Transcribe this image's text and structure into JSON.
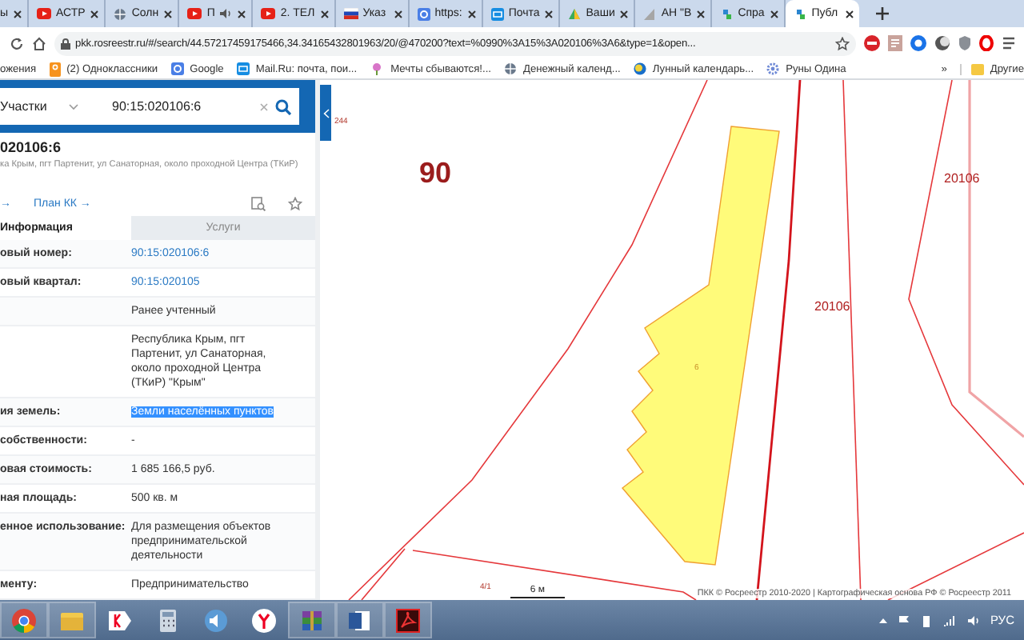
{
  "browser": {
    "tabs": [
      {
        "title": "ы",
        "kind": "none",
        "audio": false,
        "selected": false
      },
      {
        "title": "АСТР",
        "kind": "youtube",
        "audio": false,
        "selected": false
      },
      {
        "title": "Солн",
        "kind": "globe",
        "audio": false,
        "selected": false
      },
      {
        "title": "П",
        "kind": "youtube",
        "audio": true,
        "selected": false
      },
      {
        "title": "2. ТЕЛ",
        "kind": "youtube",
        "audio": false,
        "selected": false
      },
      {
        "title": "Указ",
        "kind": "flag",
        "audio": false,
        "selected": false
      },
      {
        "title": "https:",
        "kind": "google",
        "audio": false,
        "selected": false
      },
      {
        "title": "Почта",
        "kind": "mail",
        "audio": false,
        "selected": false
      },
      {
        "title": "Ваши",
        "kind": "drive",
        "audio": false,
        "selected": false
      },
      {
        "title": "АН \"В",
        "kind": "triangle",
        "audio": false,
        "selected": false
      },
      {
        "title": "Спра",
        "kind": "pkk",
        "audio": false,
        "selected": false
      },
      {
        "title": "Публ",
        "kind": "pkk",
        "audio": false,
        "selected": true
      }
    ],
    "url": "pkk.rosreestr.ru/#/search/44.57217459175466,34.34165432801963/20/@470200?text=%0990%3A15%3A020106%3A6&type=1&open...",
    "bookmarks": [
      {
        "title": "ожения",
        "kind": "none"
      },
      {
        "title": "(2) Одноклассники",
        "kind": "ok"
      },
      {
        "title": "Google",
        "kind": "google"
      },
      {
        "title": "Mail.Ru: почта, пои...",
        "kind": "mail"
      },
      {
        "title": "Мечты сбываются!...",
        "kind": "flower"
      },
      {
        "title": "Денежный календ...",
        "kind": "globe"
      },
      {
        "title": "Лунный календарь...",
        "kind": "moon"
      },
      {
        "title": "Руны Одина",
        "kind": "gear"
      }
    ],
    "more": "»",
    "other": "Другие"
  },
  "panel": {
    "search": {
      "category": "Участки",
      "value": "90:15:020106:6"
    },
    "title": "020106:6",
    "address": "ка Крым, пгт Партенит, ул Санаторная, около проходной Центра (ТКиР)",
    "links": [
      "→",
      "План КК →"
    ],
    "tabs": [
      {
        "label": "Информация",
        "selected": true
      },
      {
        "label": "Услуги",
        "selected": false
      }
    ],
    "rows": [
      {
        "label": "овый номер:",
        "value": "90:15:020106:6",
        "kind": "link"
      },
      {
        "label": "овый квартал:",
        "value": "90:15:020105",
        "kind": "link"
      },
      {
        "value": "Ранее учтенный",
        "kind": "text"
      },
      {
        "value": "Республика Крым, пгт Партенит, ул Санаторная, около проходной Центра (ТКиР) \"Крым\"",
        "kind": "text"
      },
      {
        "label": "ия земель:",
        "value": "Земли населённых пунктов",
        "kind": "selected_text"
      },
      {
        "label": "собственности:",
        "value": "-",
        "kind": "text"
      },
      {
        "label": "овая стоимость:",
        "value": "1 685 166,5 руб.",
        "kind": "text"
      },
      {
        "label": "ная площадь:",
        "value": "500 кв. м",
        "kind": "text"
      },
      {
        "label": "енное использование:",
        "value": "Для размещения объектов предпринимательской деятельности",
        "kind": "text"
      },
      {
        "label": "менту:",
        "value": "Предпринимательство",
        "kind": "text"
      }
    ]
  },
  "map": {
    "labels": [
      {
        "text": "244",
        "kind": "small"
      },
      {
        "text": "90",
        "kind": "block"
      },
      {
        "text": "20106",
        "kind": "quarter"
      },
      {
        "text": "20106",
        "kind": "quarter"
      },
      {
        "text": "6",
        "kind": "parcel"
      },
      {
        "text": "4/1",
        "kind": "small"
      }
    ],
    "scale": "6 м",
    "copyright": "ПКК © Росреестр 2010-2020 | Картографическая основа РФ © Росреестр 2011"
  },
  "taskbar": {
    "language": "РУС"
  }
}
